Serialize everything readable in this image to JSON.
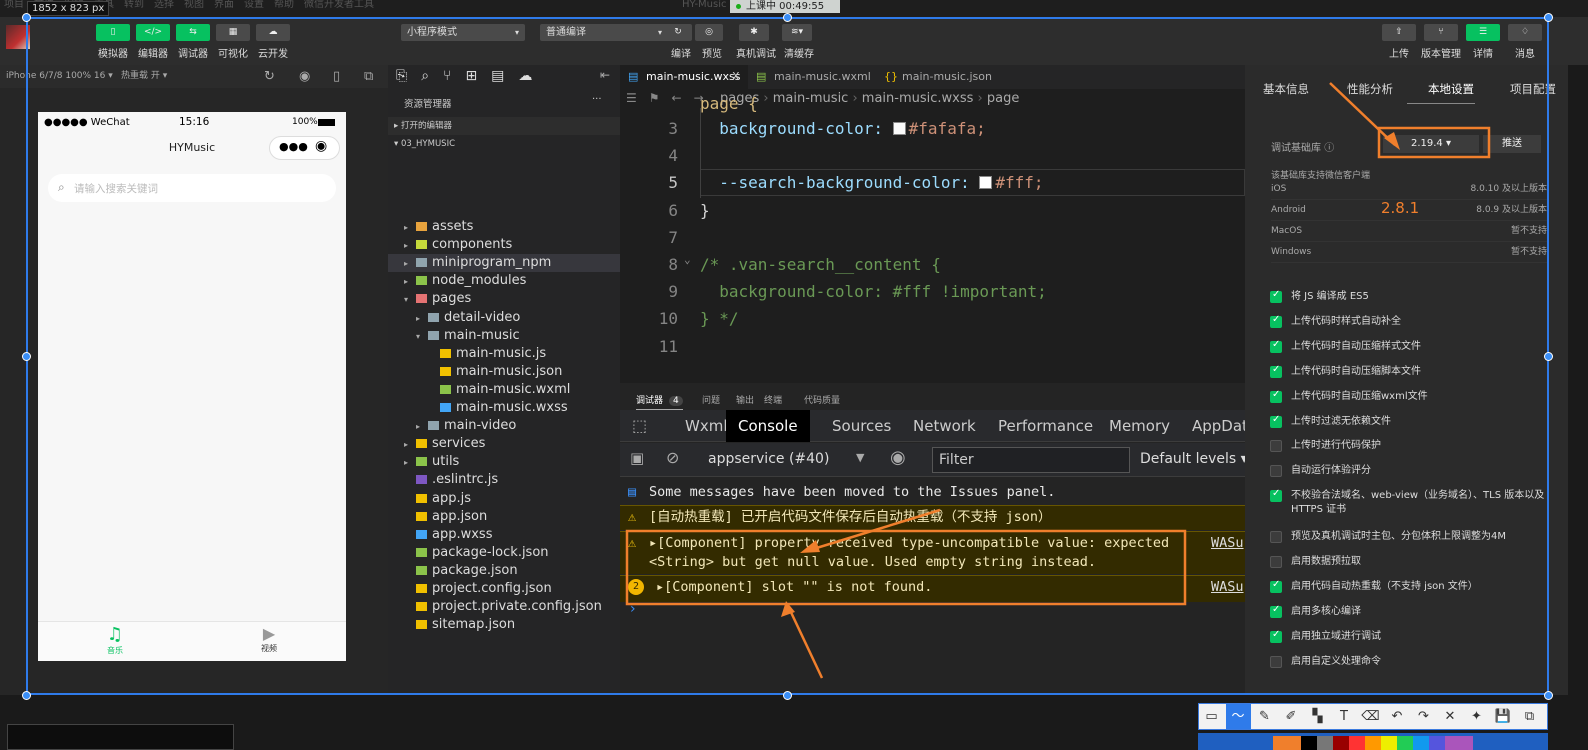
{
  "screen_capture": {
    "dimensions": "1852 x 823  px",
    "recording": "上课中 00:49:55"
  },
  "menubar": [
    "项目",
    "文件",
    "编辑",
    "工具",
    "转到",
    "选择",
    "视图",
    "界面",
    "设置",
    "帮助",
    "微信开发者工具"
  ],
  "window_title": "HY-Music",
  "toolbar": {
    "left": [
      {
        "label": "模拟器",
        "icon": "phone-icon",
        "active": true
      },
      {
        "label": "编辑器",
        "icon": "code-icon",
        "active": true
      },
      {
        "label": "调试器",
        "icon": "debug-icon",
        "active": true
      },
      {
        "label": "可视化",
        "icon": "layout-icon",
        "active": false
      },
      {
        "label": "云开发",
        "icon": "cloud-icon",
        "active": false
      }
    ],
    "mode_select": "小程序模式",
    "compile_select": "普通编译",
    "mid": [
      {
        "label": "编译",
        "icon": "refresh-icon"
      },
      {
        "label": "预览",
        "icon": "eye-icon"
      },
      {
        "label": "真机调试",
        "icon": "bug-icon"
      },
      {
        "label": "清缓存",
        "icon": "layers-icon"
      }
    ],
    "right": [
      {
        "label": "上传",
        "icon": "upload-icon"
      },
      {
        "label": "版本管理",
        "icon": "branch-icon"
      },
      {
        "label": "详情",
        "icon": "menu-icon",
        "active": true
      },
      {
        "label": "消息",
        "icon": "bell-icon"
      }
    ]
  },
  "simulator": {
    "device": "iPhone 6/7/8 100% 16 ▾",
    "hot_reload": "热重载 开 ▾",
    "status": {
      "carrier": "●●●●● WeChat",
      "time": "15:16",
      "battery": "100%"
    },
    "nav_title": "HYMusic",
    "search_placeholder": "请输入搜索关键词",
    "tabbar": [
      {
        "label": "音乐",
        "active": true
      },
      {
        "label": "视频",
        "active": false
      }
    ]
  },
  "explorer": {
    "title": "资源管理器",
    "more": "···",
    "open_editors": "打开的编辑器",
    "project": "03_HYMUSIC",
    "items": [
      {
        "name": "assets",
        "type": "folder",
        "depth": 0,
        "color": "#e8a33d"
      },
      {
        "name": "components",
        "type": "folder",
        "depth": 0,
        "color": "#c5d93b"
      },
      {
        "name": "miniprogram_npm",
        "type": "folder",
        "depth": 0,
        "color": "#90a4ae",
        "selected": true
      },
      {
        "name": "node_modules",
        "type": "folder",
        "depth": 0,
        "color": "#8bc34a"
      },
      {
        "name": "pages",
        "type": "folder-open",
        "depth": 0,
        "color": "#e57373"
      },
      {
        "name": "detail-video",
        "type": "folder",
        "depth": 1,
        "color": "#90a4ae"
      },
      {
        "name": "main-music",
        "type": "folder-open",
        "depth": 1,
        "color": "#90a4ae"
      },
      {
        "name": "main-music.js",
        "type": "js",
        "depth": 2,
        "color": "#f0c000"
      },
      {
        "name": "main-music.json",
        "type": "json",
        "depth": 2,
        "color": "#f0c000"
      },
      {
        "name": "main-music.wxml",
        "type": "wxml",
        "depth": 2,
        "color": "#8bc34a"
      },
      {
        "name": "main-music.wxss",
        "type": "wxss",
        "depth": 2,
        "color": "#42a5f5"
      },
      {
        "name": "main-video",
        "type": "folder",
        "depth": 1,
        "color": "#90a4ae"
      },
      {
        "name": "services",
        "type": "folder",
        "depth": 0,
        "color": "#f0c000"
      },
      {
        "name": "utils",
        "type": "folder",
        "depth": 0,
        "color": "#8bc34a"
      },
      {
        "name": ".eslintrc.js",
        "type": "eslint",
        "depth": 0,
        "color": "#7e57c2"
      },
      {
        "name": "app.js",
        "type": "js",
        "depth": 0,
        "color": "#f0c000"
      },
      {
        "name": "app.json",
        "type": "json",
        "depth": 0,
        "color": "#f0c000"
      },
      {
        "name": "app.wxss",
        "type": "wxss",
        "depth": 0,
        "color": "#42a5f5"
      },
      {
        "name": "package-lock.json",
        "type": "npm",
        "depth": 0,
        "color": "#8bc34a"
      },
      {
        "name": "package.json",
        "type": "npm",
        "depth": 0,
        "color": "#8bc34a"
      },
      {
        "name": "project.config.json",
        "type": "json",
        "depth": 0,
        "color": "#f0c000"
      },
      {
        "name": "project.private.config.json",
        "type": "json",
        "depth": 0,
        "color": "#f0c000"
      },
      {
        "name": "sitemap.json",
        "type": "json",
        "depth": 0,
        "color": "#f0c000"
      }
    ]
  },
  "editor": {
    "tabs": [
      {
        "label": "main-music.wxss",
        "active": true,
        "icon": "wxss-icon",
        "close": "X"
      },
      {
        "label": "main-music.wxml",
        "icon": "wxml-icon"
      },
      {
        "label": "main-music.json",
        "icon": "json-icon"
      }
    ],
    "breadcrumb": [
      "pages",
      "main-music",
      "main-music.wxss",
      "page"
    ],
    "lines": [
      {
        "n": "3",
        "text": "  background-color: ",
        "swatch": "#fafafa",
        "value": "#fafafa;"
      },
      {
        "n": "4",
        "text": ""
      },
      {
        "n": "5",
        "text": "  --search-background-color: ",
        "swatch": "#ffffff",
        "value": "#fff;",
        "current": true
      },
      {
        "n": "6",
        "text": "}"
      },
      {
        "n": "7",
        "text": ""
      },
      {
        "n": "8",
        "text": "/* .van-search__content {",
        "comment": true
      },
      {
        "n": "9",
        "text": "  background-color: #fff !important;",
        "comment": true
      },
      {
        "n": "10",
        "text": "} */",
        "comment": true
      },
      {
        "n": "11",
        "text": ""
      }
    ]
  },
  "debugger": {
    "tabs": [
      {
        "label": "调试器",
        "badge": "4",
        "active": true
      },
      {
        "label": "问题"
      },
      {
        "label": "输出"
      },
      {
        "label": "终端"
      },
      {
        "label": "代码质量"
      }
    ],
    "devtools_tabs": [
      "Wxml",
      "Console",
      "Sources",
      "Network",
      "Performance",
      "Memory",
      "AppData"
    ],
    "active_devtab": "Console",
    "context": "appservice (#40)",
    "filter_placeholder": "Filter",
    "levels": "Default levels ▾",
    "messages": [
      {
        "type": "info",
        "text": "Some messages have been moved to the Issues panel."
      },
      {
        "type": "warning",
        "text": "[自动热重载] 已开启代码文件保存后自动热重载（不支持 json）"
      },
      {
        "type": "warning",
        "text": "▸[Component] property received type-uncompatible value: expected\n<String> but get null value. Used empty string instead.",
        "source": "WASu"
      },
      {
        "type": "warning",
        "count": "2",
        "text": "▸[Component] slot \"\" is not found.",
        "source": "WASu"
      }
    ],
    "prompt": "›"
  },
  "details_panel": {
    "tabs": [
      "基本信息",
      "性能分析",
      "本地设置",
      "项目配置"
    ],
    "active_tab": "本地设置",
    "lib_label": "调试基础库",
    "lib_version": "2.19.4 ▾",
    "push_button": "推送",
    "support_title": "该基础库支持微信客户端",
    "support": [
      {
        "os": "iOS",
        "ver": "8.0.10 及以上版本"
      },
      {
        "os": "Android",
        "ver": "8.0.9 及以上版本"
      },
      {
        "os": "MacOS",
        "ver": "暂不支持"
      },
      {
        "os": "Windows",
        "ver": "暂不支持"
      }
    ],
    "settings": [
      {
        "label": "将 JS 编译成 ES5",
        "checked": true
      },
      {
        "label": "上传代码时样式自动补全",
        "checked": true
      },
      {
        "label": "上传代码时自动压缩样式文件",
        "checked": true
      },
      {
        "label": "上传代码时自动压缩脚本文件",
        "checked": true
      },
      {
        "label": "上传代码时自动压缩wxml文件",
        "checked": true
      },
      {
        "label": "上传时过滤无依赖文件",
        "checked": true
      },
      {
        "label": "上传时进行代码保护",
        "checked": false
      },
      {
        "label": "自动运行体验评分",
        "checked": false
      },
      {
        "label": "不校验合法域名、web-view（业务域名）、TLS 版本以及 HTTPS 证书",
        "checked": true,
        "two": true
      },
      {
        "label": "预览及真机调试时主包、分包体积上限调整为4M",
        "checked": false
      },
      {
        "label": "启用数据预拉取",
        "checked": false
      },
      {
        "label": "启用代码自动热重载（不支持 json 文件）",
        "checked": true
      },
      {
        "label": "启用多核心编译",
        "checked": true
      },
      {
        "label": "启用独立域进行调试",
        "checked": true
      },
      {
        "label": "启用自定义处理命令",
        "checked": false
      }
    ]
  },
  "annotation": {
    "text": "2.8.1",
    "color": "#f07f2c"
  },
  "draw_toolbar": [
    "rect-icon",
    "line-icon",
    "pen-icon",
    "marker-icon",
    "mosaic-icon",
    "text-icon",
    "eraser-icon",
    "undo-icon",
    "redo-icon",
    "close-icon",
    "pin-icon",
    "save-icon",
    "copy-icon"
  ],
  "colors": {
    "accent": "#07c160",
    "selection": "#2f7bea",
    "annotation": "#f07f2c"
  }
}
